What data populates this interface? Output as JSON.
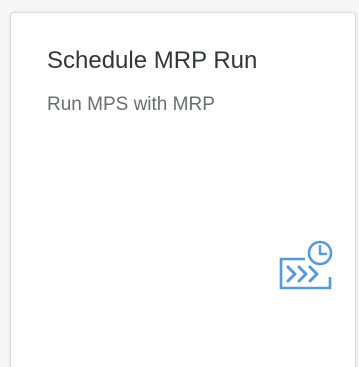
{
  "tile": {
    "title": "Schedule MRP Run",
    "subtitle": "Run MPS with MRP",
    "icon": "scheduled-run-icon",
    "icon_color": "#5899da"
  }
}
